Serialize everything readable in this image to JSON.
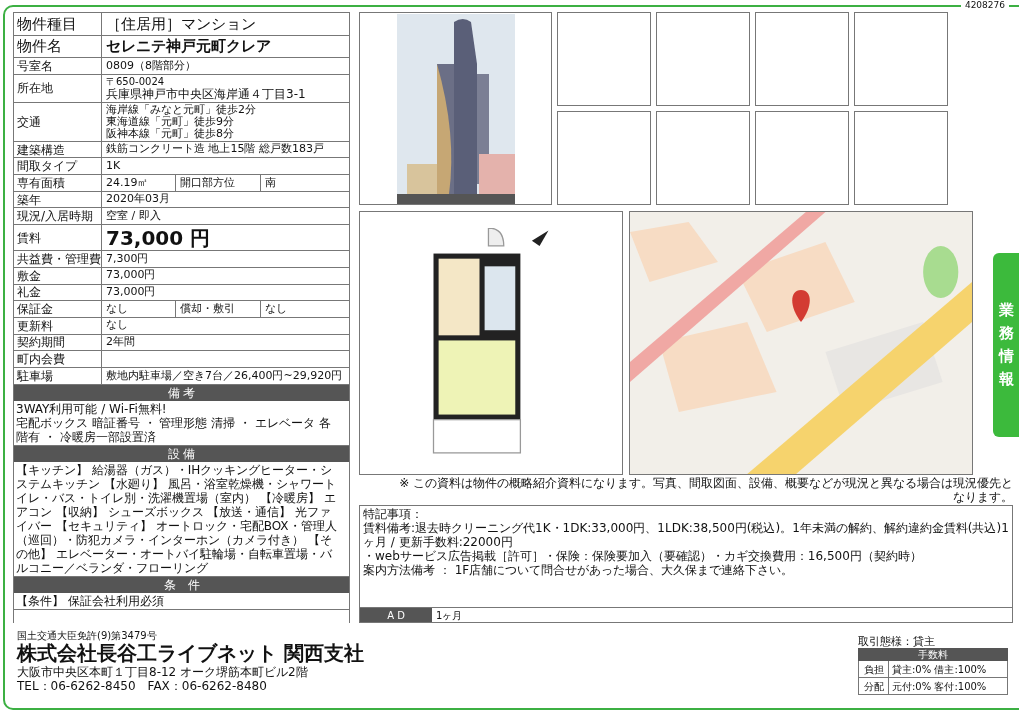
{
  "ref_number": "4208276",
  "side_tab": {
    "label": "業務情報"
  },
  "property_table": [
    {
      "kind": "title",
      "label": "物件種目",
      "value": "［住居用］マンション"
    },
    {
      "kind": "title_bold",
      "label": "物件名",
      "value": "セレニテ神戸元町クレア"
    },
    {
      "kind": "single",
      "label": "号室名",
      "value": "0809（8階部分）"
    },
    {
      "kind": "address",
      "label": "所在地",
      "postal": "〒650-0024",
      "value": "兵庫県神戸市中央区海岸通４丁目3-1"
    },
    {
      "kind": "lines",
      "label": "交通",
      "lines": [
        "海岸線「みなと元町」徒歩2分",
        "東海道線「元町」徒歩9分",
        "阪神本線「元町」徒歩8分"
      ]
    },
    {
      "kind": "single",
      "label": "建築構造",
      "value": "鉄筋コンクリート造 地上15階 総戸数183戸"
    },
    {
      "kind": "single",
      "label": "間取タイプ",
      "value": "1K"
    },
    {
      "kind": "split",
      "label": "専有面積",
      "value": "24.19㎡",
      "label2": "開口部方位",
      "value2": "南"
    },
    {
      "kind": "single",
      "label": "築年",
      "value": "2020年03月"
    },
    {
      "kind": "single",
      "label": "現況/入居時期",
      "value": "空室 / 即入"
    },
    {
      "kind": "rent",
      "label": "賃料",
      "value": "73,000 円"
    },
    {
      "kind": "single",
      "label": "共益費・管理費",
      "value": "7,300円"
    },
    {
      "kind": "single",
      "label": "敷金",
      "value": "73,000円"
    },
    {
      "kind": "single",
      "label": "礼金",
      "value": "73,000円"
    },
    {
      "kind": "split",
      "label": "保証金",
      "value": "なし",
      "label2": "償却・敷引",
      "value2": "なし"
    },
    {
      "kind": "single",
      "label": "更新料",
      "value": "なし"
    },
    {
      "kind": "single",
      "label": "契約期間",
      "value": "2年間"
    },
    {
      "kind": "single",
      "label": "町内会費"
    },
    {
      "kind": "single",
      "label": "駐車場",
      "value": "敷地内駐車場／空き7台／26,400円~29,920円"
    }
  ],
  "sections": [
    {
      "heading": "備 考",
      "lines": [
        "3WAY利用可能 / Wi-Fi無料!",
        "宅配ボックス 暗証番号 ・ 管理形態 清掃 ・ エレベータ 各階有 ・ 冷暖房一部設置済"
      ]
    },
    {
      "heading": "設 備",
      "lines": [
        "【キッチン】 給湯器（ガス）・IHクッキングヒーター・システムキッチン 【水廻り】 風呂・浴室乾燥機・シャワートイレ・バス・トイレ別・洗濯機置場（室内） 【冷暖房】 エアコン 【収納】 シューズボックス 【放送・通信】 光ファイバー 【セキュリティ】 オートロック・宅配BOX・管理人（巡回）・防犯カメラ・インターホン（カメラ付き） 【その他】 エレベーター・オートバイ駐輪場・自転車置場・バルコニー／ベランダ・フローリング"
      ]
    },
    {
      "heading": "条　件",
      "lines": [
        "【条件】 保証会社利用必須"
      ]
    }
  ],
  "disclaimer": "※ この資料は物件の概略紹介資料になります。写真、間取図面、設備、概要などが現況と異なる場合は現況優先となります。",
  "notes": {
    "lines": [
      "特記事項：",
      "賃料備考:退去時クリーニング代1K・1DK:33,000円、1LDK:38,500円(税込)。1年未満の解約、解約違約金賃料(共込)1ヶ月 / 更新手数料:22000円",
      "・webサービス広告掲載［許可］・保険：保険要加入（要確認）・カギ交換費用：16,500円（契約時）",
      "案内方法備考 ： 1F店舗について問合せがあった場合、大久保まで連絡下さい。"
    ],
    "ad_label": "A D",
    "ad_value": "1ヶ月"
  },
  "footer": {
    "license": "国土交通大臣免許(9)第3479号",
    "company": "株式会社長谷工ライブネット 関西支社",
    "address": "大阪市中央区本町１丁目8-12 オーク堺筋本町ビル2階",
    "phone": "TEL：06-6262-8450　FAX：06-6262-8480",
    "transaction": "取引態様：貸主",
    "fee_heading": "手数料",
    "fee_rows": [
      {
        "label": "負担",
        "value": "貸主:0% 借主:100%"
      },
      {
        "label": "分配",
        "value": "元付:0% 客付:100%"
      }
    ]
  }
}
